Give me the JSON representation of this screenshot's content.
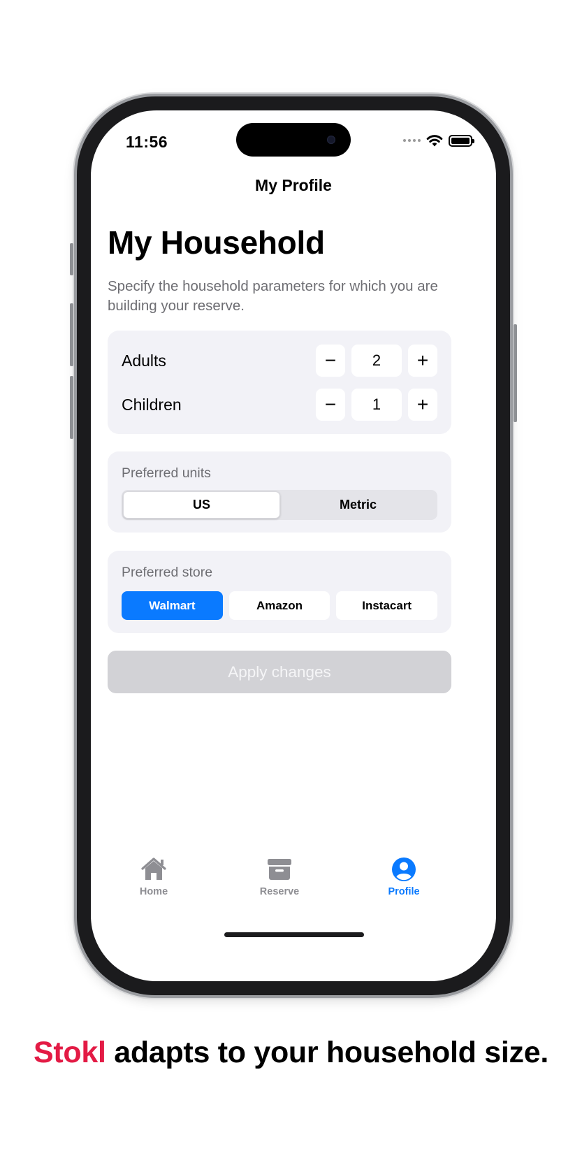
{
  "status_bar": {
    "time": "11:56"
  },
  "nav": {
    "title": "My Profile"
  },
  "household": {
    "title": "My Household",
    "description": "Specify the household parameters for which you are building your reserve.",
    "adults": {
      "label": "Adults",
      "value": "2",
      "minus": "−",
      "plus": "+"
    },
    "children": {
      "label": "Children",
      "value": "1",
      "minus": "−",
      "plus": "+"
    }
  },
  "units": {
    "label": "Preferred units",
    "options": [
      "US",
      "Metric"
    ],
    "selected": "US"
  },
  "store": {
    "label": "Preferred store",
    "options": [
      "Walmart",
      "Amazon",
      "Instacart"
    ],
    "selected": "Walmart"
  },
  "apply_button": {
    "label": "Apply changes",
    "enabled": false
  },
  "tab_bar": {
    "tabs": [
      {
        "label": "Home",
        "icon": "house-icon"
      },
      {
        "label": "Reserve",
        "icon": "archivebox-icon"
      },
      {
        "label": "Profile",
        "icon": "person-circle-icon"
      }
    ],
    "active": "Profile"
  },
  "caption": {
    "brand": "Stokl",
    "text": "adapts to your household size."
  },
  "colors": {
    "accent": "#0a7aff",
    "brand": "#e31b45",
    "card_bg": "#f2f2f7",
    "disabled_button": "#d2d2d6",
    "inactive_tab": "#8e8e93"
  }
}
